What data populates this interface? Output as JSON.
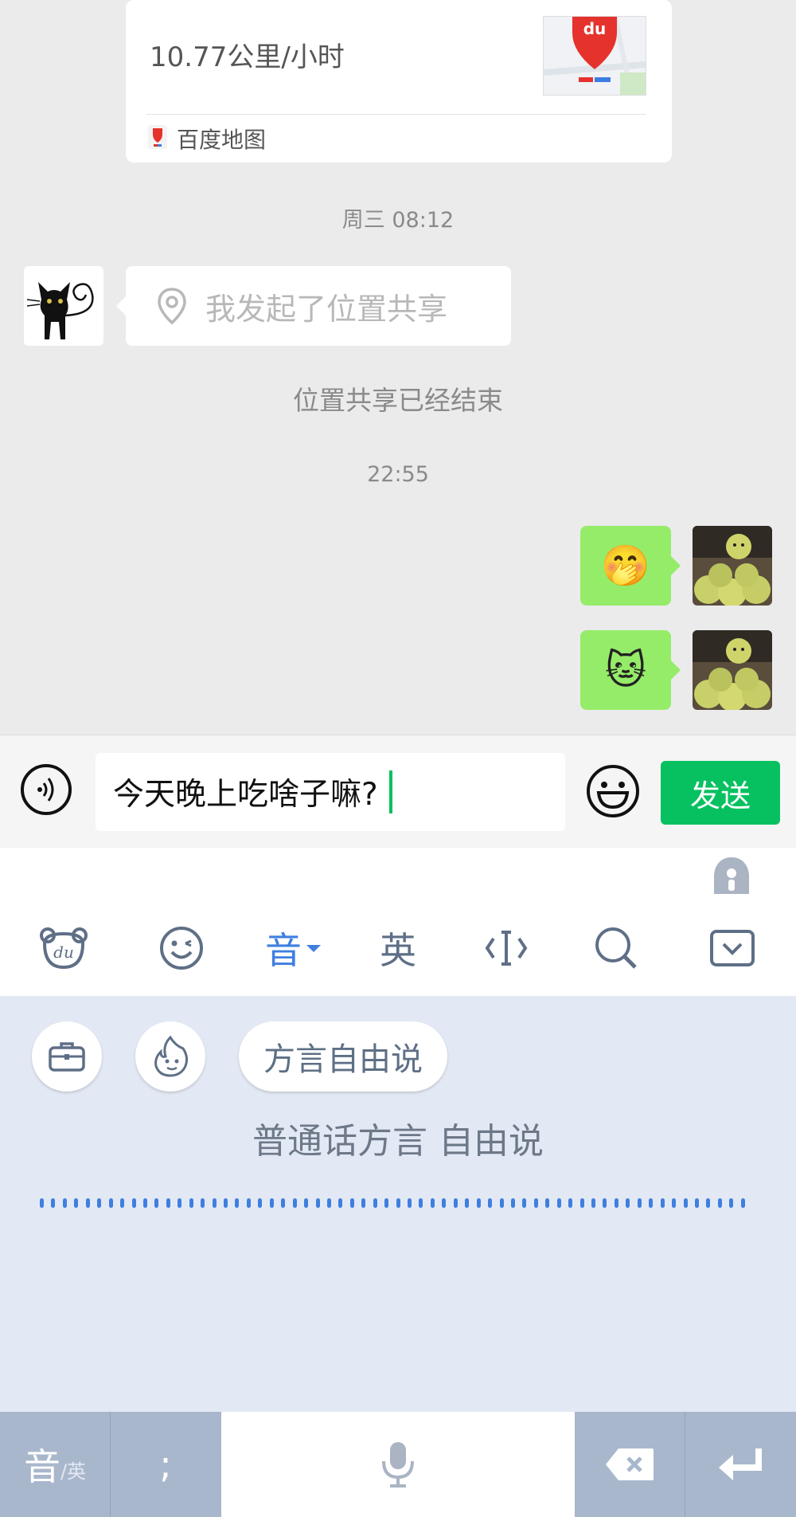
{
  "location_card": {
    "speed": "10.77公里/小时",
    "source": "百度地图",
    "map_icon_label": "du"
  },
  "chat": {
    "timestamp_1": "周三 08:12",
    "incoming_message": "我发起了位置共享",
    "system_message": "位置共享已经结束",
    "timestamp_2": "22:55",
    "outgoing": [
      {
        "emoji": "🤭"
      },
      {
        "emoji": "🐱"
      }
    ]
  },
  "input_bar": {
    "text_value": "今天晚上吃啥子嘛?",
    "send_label": "发送"
  },
  "keyboard": {
    "toolbar": {
      "logo": "du",
      "pinyin": "音",
      "english": "英"
    },
    "panel": {
      "dialect_pill": "方言自由说",
      "hint": "普通话方言 自由说"
    },
    "bottom": {
      "lang_main": "音",
      "lang_sub": "/英",
      "punct": ";"
    }
  },
  "colors": {
    "wechat_green": "#07c160",
    "bubble_green": "#95ec69",
    "keyboard_accent": "#3f7fe0"
  }
}
